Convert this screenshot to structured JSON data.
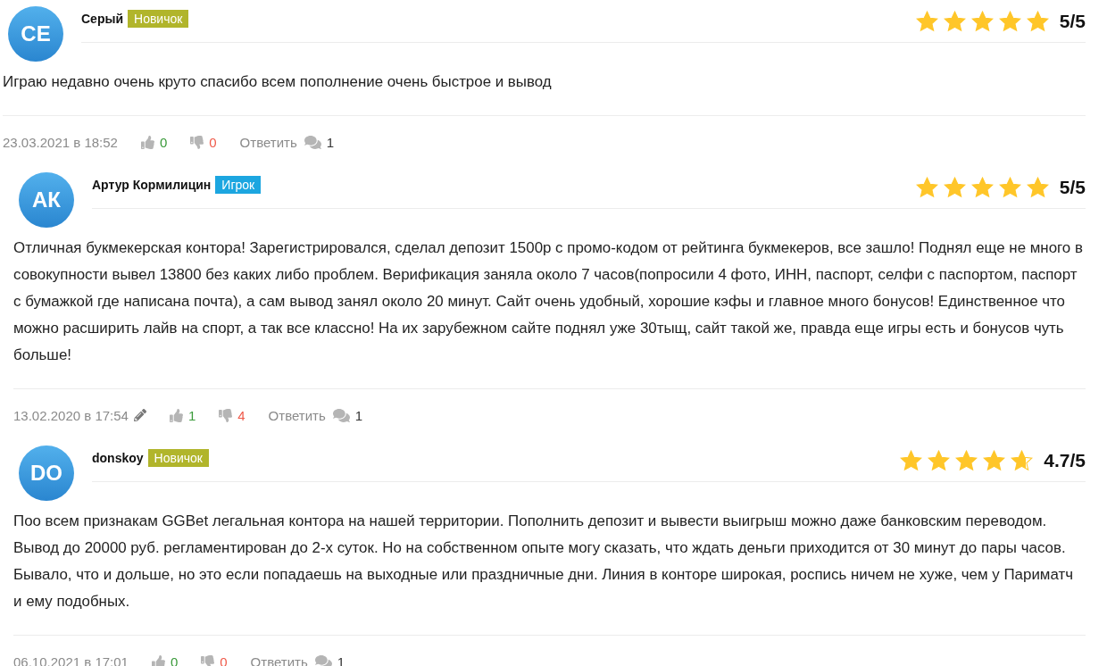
{
  "reviews": [
    {
      "initials": "СЕ",
      "author": "Серый",
      "badge": {
        "label": "Новичок",
        "color": "#b1b52b"
      },
      "stars": 5,
      "rating": "5/5",
      "text": "Играю недавно очень круто спасибо всем пополнение очень быстрое и вывод",
      "date": "23.03.2021 в 18:52",
      "edited": false,
      "likes": "0",
      "dislikes": "0",
      "reply": "Ответить",
      "comments": "1"
    },
    {
      "initials": "АК",
      "author": "Артур Кормилицин",
      "badge": {
        "label": "Игрок",
        "color": "#1ca6e0"
      },
      "stars": 5,
      "rating": "5/5",
      "text": "Отличная букмекерская контора! Зарегистрировался, сделал депозит 1500р с промо-кодом от рейтинга букмекеров, все зашло! Поднял еще не много в совокупности вывел 13800 без каких либо проблем. Верификация заняла около 7 часов(попросили 4 фото, ИНН, паспорт, селфи с паспортом, паспорт с бумажкой где написана почта), а сам вывод занял около 20 минут. Сайт очень удобный, хорошие кэфы и главное много бонусов! Единственное что можно расширить лайв на спорт, а так все классно! На их зарубежном сайте поднял уже 30тыщ, сайт такой же, правда еще игры есть и бонусов чуть больше!",
      "date": "13.02.2020 в 17:54",
      "edited": true,
      "likes": "1",
      "dislikes": "4",
      "reply": "Ответить",
      "comments": "1"
    },
    {
      "initials": "DO",
      "author": "donskoy",
      "badge": {
        "label": "Новичок",
        "color": "#b1b52b"
      },
      "stars": 4.7,
      "rating": "4.7/5",
      "text": "Поо всем признакам GGBet легальная контора на нашей территории. Пополнить депозит и вывести выигрыш можно даже банковским переводом. Вывод до 20000 руб. регламентирован до 2-х суток. Но на собственном опыте могу сказать, что ждать деньги приходится от 30 минут до пары часов. Бывало, что и дольше, но это если попадаешь на выходные или праздничные дни. Линия в конторе широкая, роспись ничем не хуже, чем у Париматч и ему подобных.",
      "date": "06.10.2021 в 17:01",
      "edited": false,
      "likes": "0",
      "dislikes": "0",
      "reply": "Ответить",
      "comments": "1"
    }
  ]
}
